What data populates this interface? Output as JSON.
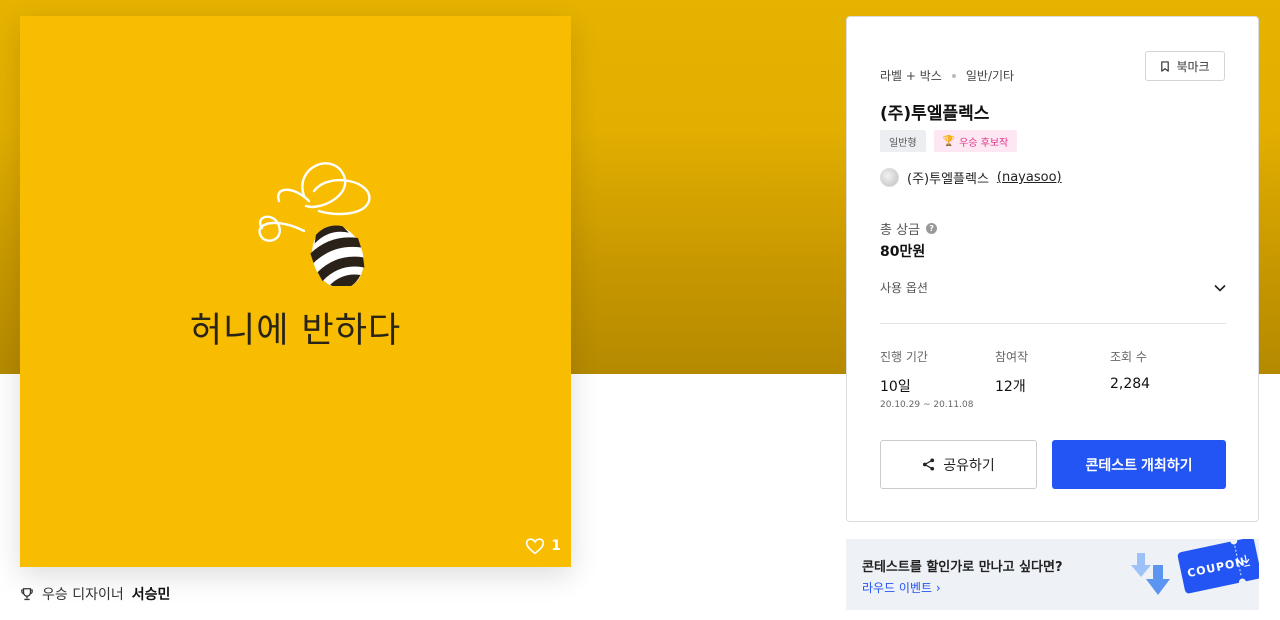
{
  "artwork": {
    "logo_text": "허니에 반하다",
    "like_count": "1",
    "brand_color": "#f8bd00"
  },
  "designer": {
    "label": "우승 디자이너",
    "name": "서승민"
  },
  "panel": {
    "category_primary": "라벨 + 박스",
    "category_secondary": "일반/기타",
    "bookmark_label": "북마크",
    "title": "(주)투엘플렉스",
    "tags": [
      "일반형",
      "우승 후보작"
    ],
    "owner_name": "(주)투엘플렉스",
    "owner_handle": "(nayasoo)",
    "prize_label": "총 상금",
    "prize_value": "80만원",
    "options_label": "사용 옵션",
    "stats": {
      "period_label": "진행 기간",
      "period_value": "10일",
      "period_range": "20.10.29 ~ 20.11.08",
      "participants_label": "참여작",
      "participants_value": "12개",
      "views_label": "조회 수",
      "views_value": "2,284"
    },
    "share_label": "공유하기",
    "host_label": "콘테스트 개최하기",
    "accent_color": "#2355f5"
  },
  "coupon_banner": {
    "question": "콘테스트를 할인가로 만나고 싶다면?",
    "link_label": "라우드 이벤트",
    "coupon_text": "COUPON"
  }
}
